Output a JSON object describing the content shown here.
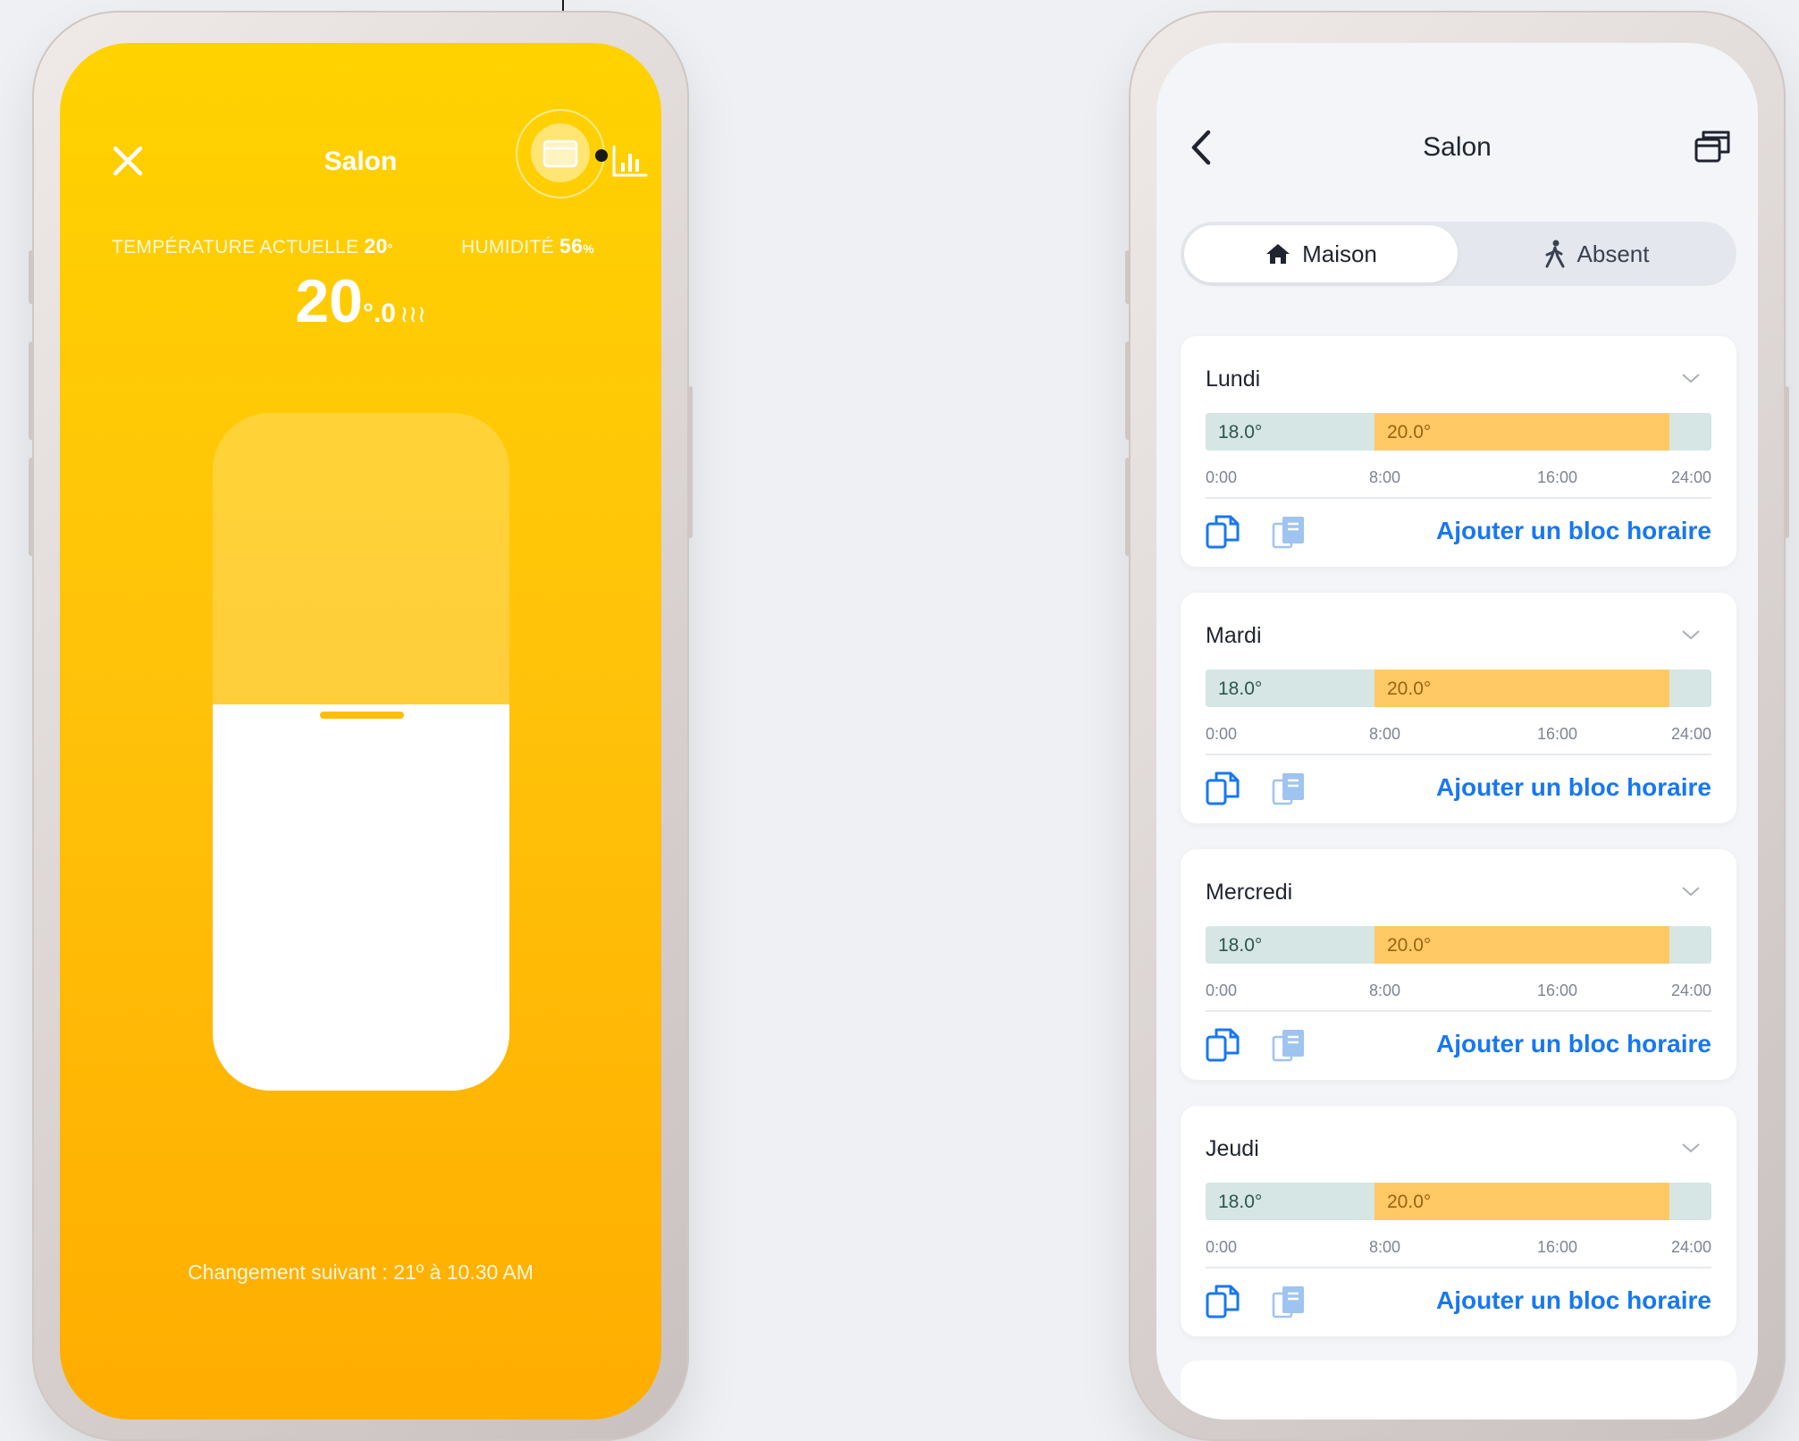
{
  "left_screen": {
    "title": "Salon",
    "current_temp_label": "TEMPÉRATURE ACTUELLE",
    "current_temp_value": "20",
    "current_temp_suffix": "°",
    "humidity_label": "HUMIDITÉ",
    "humidity_value": "56",
    "humidity_unit": "%",
    "setpoint_int": "20",
    "setpoint_dec": "°.0",
    "slider_level_fraction": 0.57,
    "next_change": "Changement suivant : 21º à 10.30 AM",
    "icons": [
      "close-icon",
      "calendar-icon",
      "bar-chart-icon",
      "heating-icon"
    ],
    "colors": {
      "accent_top": "#ffd200",
      "accent_bottom": "#ffad00"
    }
  },
  "right_screen": {
    "title": "Salon",
    "icons": [
      "back-chevron-icon",
      "copy-schedule-icon",
      "home-icon",
      "walking-person-icon",
      "chevron-down-icon",
      "copy-icon",
      "paste-icon"
    ],
    "modes": [
      {
        "label": "Maison",
        "active": true
      },
      {
        "label": "Absent",
        "active": false
      }
    ],
    "add_block_label": "Ajouter un bloc horaire",
    "timeline_ticks": [
      "0:00",
      "8:00",
      "16:00",
      "24:00"
    ],
    "days": [
      {
        "name": "Lundi",
        "blocks": [
          {
            "start": 0,
            "end": 8,
            "temp": "18.0°"
          },
          {
            "start": 8,
            "end": 22,
            "temp": "20.0°"
          },
          {
            "start": 22,
            "end": 24,
            "temp": ""
          }
        ]
      },
      {
        "name": "Mardi",
        "blocks": [
          {
            "start": 0,
            "end": 8,
            "temp": "18.0°"
          },
          {
            "start": 8,
            "end": 22,
            "temp": "20.0°"
          },
          {
            "start": 22,
            "end": 24,
            "temp": ""
          }
        ]
      },
      {
        "name": "Mercredi",
        "blocks": [
          {
            "start": 0,
            "end": 8,
            "temp": "18.0°"
          },
          {
            "start": 8,
            "end": 22,
            "temp": "20.0°"
          },
          {
            "start": 22,
            "end": 24,
            "temp": ""
          }
        ]
      },
      {
        "name": "Jeudi",
        "blocks": [
          {
            "start": 0,
            "end": 8,
            "temp": "18.0°"
          },
          {
            "start": 8,
            "end": 22,
            "temp": "20.0°"
          },
          {
            "start": 22,
            "end": 24,
            "temp": ""
          }
        ]
      }
    ],
    "colors": {
      "cool_block": "#d5e6e4",
      "warm_block": "#ffc966",
      "link": "#1877f2"
    }
  }
}
